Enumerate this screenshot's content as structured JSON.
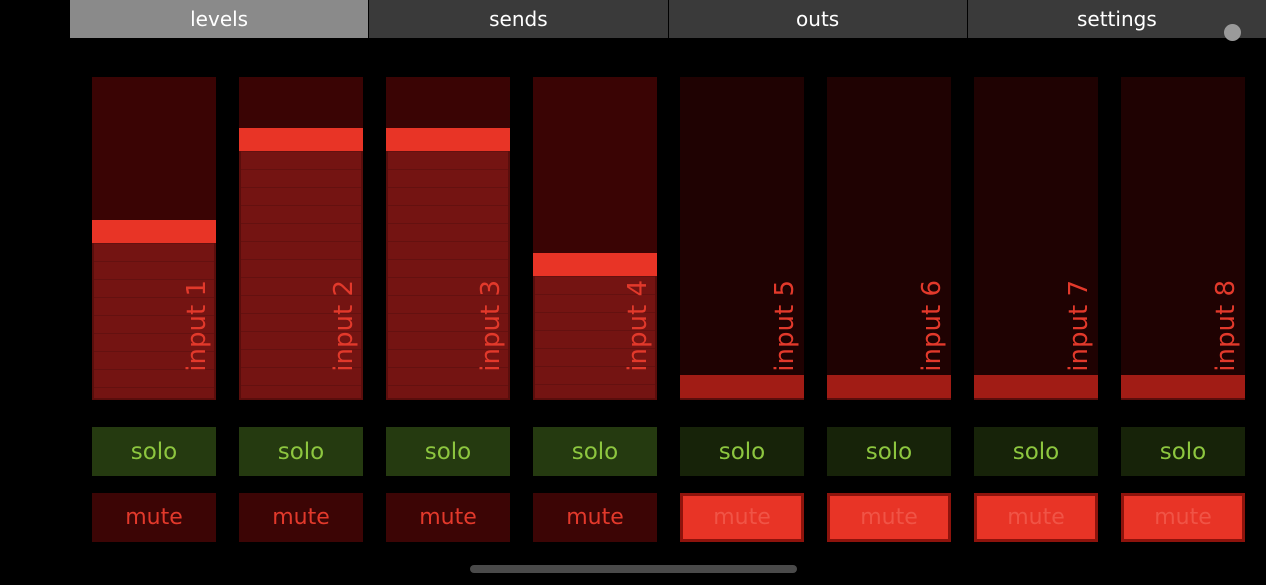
{
  "tabs": [
    {
      "label": "levels",
      "active": true
    },
    {
      "label": "sends",
      "active": false
    },
    {
      "label": "outs",
      "active": false
    },
    {
      "label": "settings",
      "active": false
    }
  ],
  "channels": [
    {
      "label": "input 1",
      "level_pct": 52,
      "solo_label": "solo",
      "mute_label": "mute",
      "muted": false
    },
    {
      "label": "input 2",
      "level_pct": 83,
      "solo_label": "solo",
      "mute_label": "mute",
      "muted": false
    },
    {
      "label": "input 3",
      "level_pct": 83,
      "solo_label": "solo",
      "mute_label": "mute",
      "muted": false
    },
    {
      "label": "input 4",
      "level_pct": 41,
      "solo_label": "solo",
      "mute_label": "mute",
      "muted": false
    },
    {
      "label": "input 5",
      "level_pct": 0,
      "solo_label": "solo",
      "mute_label": "mute",
      "muted": true
    },
    {
      "label": "input 6",
      "level_pct": 0,
      "solo_label": "solo",
      "mute_label": "mute",
      "muted": true
    },
    {
      "label": "input 7",
      "level_pct": 0,
      "solo_label": "solo",
      "mute_label": "mute",
      "muted": true
    },
    {
      "label": "input 8",
      "level_pct": 0,
      "solo_label": "solo",
      "mute_label": "mute",
      "muted": true
    }
  ],
  "colors": {
    "accent_red": "#e83426",
    "solo_green_text": "#8dc63f",
    "active_tab": "#8a8a8a",
    "inactive_tab": "#3a3a3a"
  }
}
